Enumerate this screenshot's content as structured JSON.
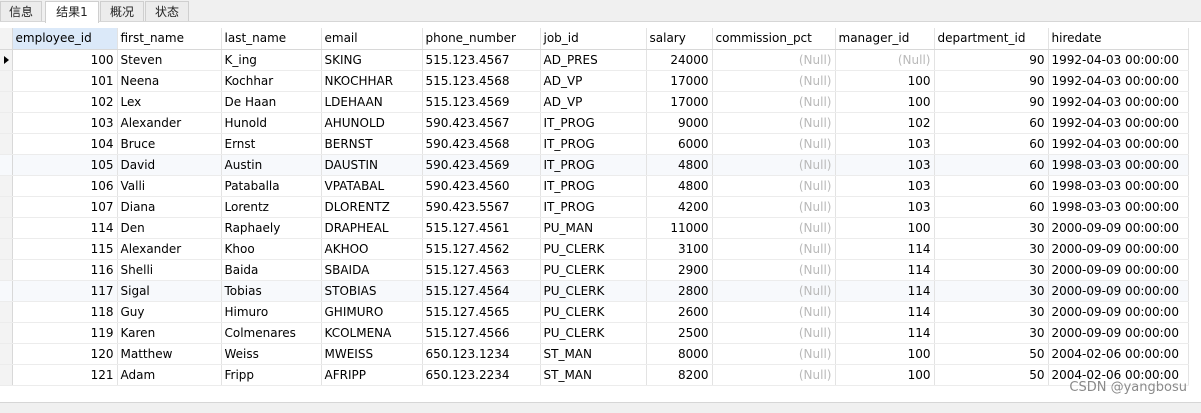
{
  "tabs": [
    {
      "label": "信息"
    },
    {
      "label": "结果1"
    },
    {
      "label": "概况"
    },
    {
      "label": "状态"
    }
  ],
  "columns": [
    "employee_id",
    "first_name",
    "last_name",
    "email",
    "phone_number",
    "job_id",
    "salary",
    "commission_pct",
    "manager_id",
    "department_id",
    "hiredate"
  ],
  "rows": [
    [
      "100",
      "Steven",
      "K_ing",
      "SKING",
      "515.123.4567",
      "AD_PRES",
      "24000",
      "(Null)",
      "(Null)",
      "90",
      "1992-04-03 00:00:00"
    ],
    [
      "101",
      "Neena",
      "Kochhar",
      "NKOCHHAR",
      "515.123.4568",
      "AD_VP",
      "17000",
      "(Null)",
      "100",
      "90",
      "1992-04-03 00:00:00"
    ],
    [
      "102",
      "Lex",
      "De Haan",
      "LDEHAAN",
      "515.123.4569",
      "AD_VP",
      "17000",
      "(Null)",
      "100",
      "90",
      "1992-04-03 00:00:00"
    ],
    [
      "103",
      "Alexander",
      "Hunold",
      "AHUNOLD",
      "590.423.4567",
      "IT_PROG",
      "9000",
      "(Null)",
      "102",
      "60",
      "1992-04-03 00:00:00"
    ],
    [
      "104",
      "Bruce",
      "Ernst",
      "BERNST",
      "590.423.4568",
      "IT_PROG",
      "6000",
      "(Null)",
      "103",
      "60",
      "1992-04-03 00:00:00"
    ],
    [
      "105",
      "David",
      "Austin",
      "DAUSTIN",
      "590.423.4569",
      "IT_PROG",
      "4800",
      "(Null)",
      "103",
      "60",
      "1998-03-03 00:00:00"
    ],
    [
      "106",
      "Valli",
      "Pataballa",
      "VPATABAL",
      "590.423.4560",
      "IT_PROG",
      "4800",
      "(Null)",
      "103",
      "60",
      "1998-03-03 00:00:00"
    ],
    [
      "107",
      "Diana",
      "Lorentz",
      "DLORENTZ",
      "590.423.5567",
      "IT_PROG",
      "4200",
      "(Null)",
      "103",
      "60",
      "1998-03-03 00:00:00"
    ],
    [
      "114",
      "Den",
      "Raphaely",
      "DRAPHEAL",
      "515.127.4561",
      "PU_MAN",
      "11000",
      "(Null)",
      "100",
      "30",
      "2000-09-09 00:00:00"
    ],
    [
      "115",
      "Alexander",
      "Khoo",
      "AKHOO",
      "515.127.4562",
      "PU_CLERK",
      "3100",
      "(Null)",
      "114",
      "30",
      "2000-09-09 00:00:00"
    ],
    [
      "116",
      "Shelli",
      "Baida",
      "SBAIDA",
      "515.127.4563",
      "PU_CLERK",
      "2900",
      "(Null)",
      "114",
      "30",
      "2000-09-09 00:00:00"
    ],
    [
      "117",
      "Sigal",
      "Tobias",
      "STOBIAS",
      "515.127.4564",
      "PU_CLERK",
      "2800",
      "(Null)",
      "114",
      "30",
      "2000-09-09 00:00:00"
    ],
    [
      "118",
      "Guy",
      "Himuro",
      "GHIMURO",
      "515.127.4565",
      "PU_CLERK",
      "2600",
      "(Null)",
      "114",
      "30",
      "2000-09-09 00:00:00"
    ],
    [
      "119",
      "Karen",
      "Colmenares",
      "KCOLMENA",
      "515.127.4566",
      "PU_CLERK",
      "2500",
      "(Null)",
      "114",
      "30",
      "2000-09-09 00:00:00"
    ],
    [
      "120",
      "Matthew",
      "Weiss",
      "MWEISS",
      "650.123.1234",
      "ST_MAN",
      "8000",
      "(Null)",
      "100",
      "50",
      "2004-02-06 00:00:00"
    ],
    [
      "121",
      "Adam",
      "Fripp",
      "AFRIPP",
      "650.123.2234",
      "ST_MAN",
      "8200",
      "(Null)",
      "100",
      "50",
      "2004-02-06 00:00:00"
    ]
  ],
  "watermark": "CSDN @yangbosu"
}
